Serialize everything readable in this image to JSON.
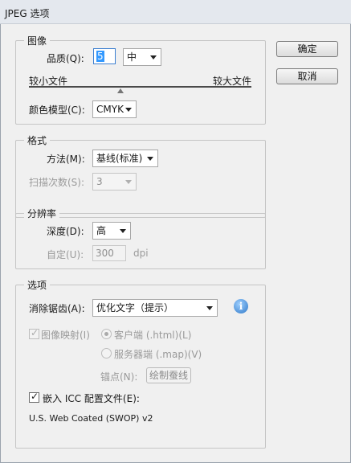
{
  "window": {
    "title": "JPEG 选项"
  },
  "buttons": {
    "ok": "确定",
    "cancel": "取消"
  },
  "image_options": {
    "legend": "图像",
    "quality_label": "品质(Q):",
    "quality_value": "5",
    "quality_level": "中",
    "smaller_file": "较小文件",
    "larger_file": "较大文件",
    "quality_slider_fraction": 0.41,
    "color_model_label": "颜色模型(C):",
    "color_model_value": "CMYK"
  },
  "format": {
    "legend": "格式",
    "method_label": "方法(M):",
    "method_value": "基线(标准)",
    "scans_label": "扫描次数(S):",
    "scans_value": "3"
  },
  "resolution": {
    "legend": "分辨率",
    "depth_label": "深度(D):",
    "depth_value": "高",
    "custom_label": "自定(U):",
    "custom_value": "300",
    "custom_unit": "dpi"
  },
  "options": {
    "legend": "选项",
    "antialias_label": "消除锯齿(A):",
    "antialias_value": "优化文字（提示）",
    "imagemap_label": "图像映射(I)",
    "client_side": "客户端 (.html)(L)",
    "server_side": "服务器端 (.map)(V)",
    "anchor_label": "锚点(N):",
    "draw_marquee": "绘制蚕线",
    "embed_icc_label": "嵌入 ICC 配置文件(E):",
    "icc_profile": "U.S. Web Coated (SWOP) v2",
    "embed_icc_checked": true,
    "imagemap_checked": true
  }
}
